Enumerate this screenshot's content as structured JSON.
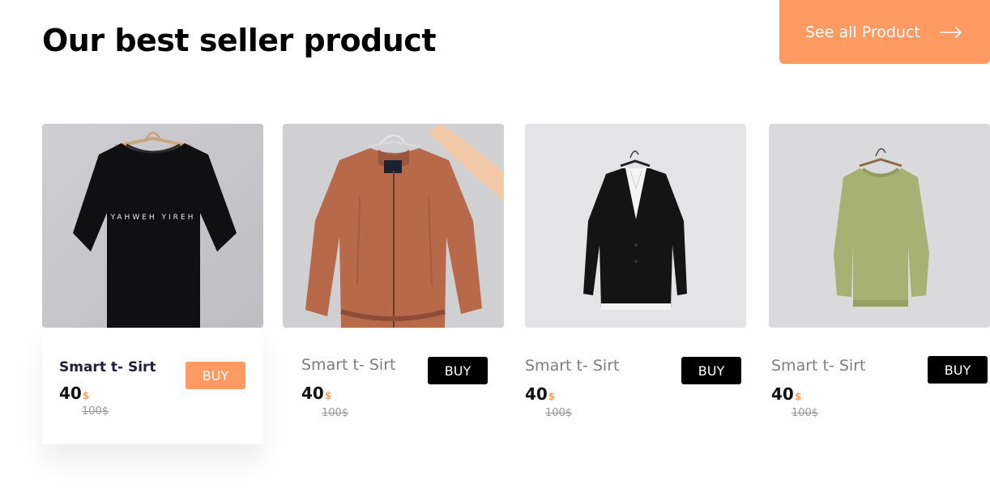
{
  "header": {
    "title": "Our best seller product",
    "see_all_label": "See all Product"
  },
  "colors": {
    "accent": "#ff9a62",
    "buy_default": "#000000"
  },
  "products": [
    {
      "name": "Smart t- Sirt",
      "price": "40",
      "currency": "$",
      "old_price": "100$",
      "buy_label": "BUY",
      "image": "black t-shirt on hanger",
      "tshirt_text": "YAHWEH YIREH"
    },
    {
      "name": "Smart t- Sirt",
      "price": "40",
      "currency": "$",
      "old_price": "100$",
      "buy_label": "BUY",
      "image": "orange bomber jacket on hanger"
    },
    {
      "name": "Smart t- Sirt",
      "price": "40",
      "currency": "$",
      "old_price": "100$",
      "buy_label": "BUY",
      "image": "black suit jacket on hanger"
    },
    {
      "name": "Smart t- Sirt",
      "price": "40",
      "currency": "$",
      "old_price": "100$",
      "buy_label": "BUY",
      "image": "green sweatshirt on hanger"
    }
  ]
}
